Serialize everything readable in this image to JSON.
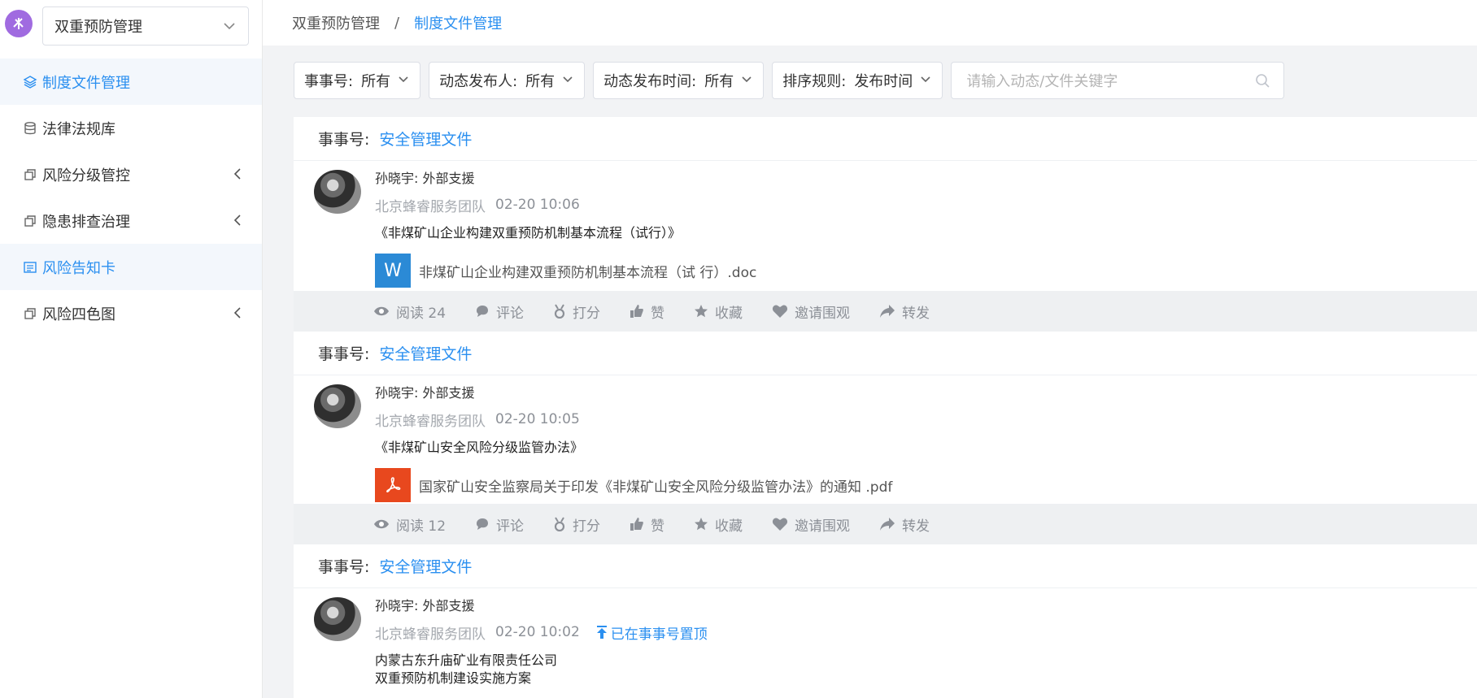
{
  "sidebar": {
    "system_selector": "双重预防管理",
    "items": [
      {
        "label": "制度文件管理",
        "icon": "layers-icon",
        "active": true,
        "expandable": false
      },
      {
        "label": "法律法规库",
        "icon": "database-icon",
        "active": false,
        "expandable": false
      },
      {
        "label": "风险分级管控",
        "icon": "copy-icon",
        "active": false,
        "expandable": true
      },
      {
        "label": "隐患排查治理",
        "icon": "copy-icon",
        "active": false,
        "expandable": true
      },
      {
        "label": "风险告知卡",
        "icon": "card-icon",
        "active": true,
        "expandable": false
      },
      {
        "label": "风险四色图",
        "icon": "copy-icon",
        "active": false,
        "expandable": true
      }
    ]
  },
  "breadcrumb": {
    "parent": "双重预防管理",
    "separator": "/",
    "current": "制度文件管理"
  },
  "filters": [
    {
      "label": "事事号:",
      "value": "所有"
    },
    {
      "label": "动态发布人:",
      "value": "所有"
    },
    {
      "label": "动态发布时间:",
      "value": "所有"
    },
    {
      "label": "排序规则:",
      "value": "发布时间"
    }
  ],
  "search": {
    "placeholder": "请输入动态/文件关键字"
  },
  "posts": [
    {
      "category_label": "事事号:",
      "category": "安全管理文件",
      "author": "孙晓宇: 外部支援",
      "team": "北京蜂睿服务团队",
      "time": "02-20 10:06",
      "title": "《非煤矿山企业构建双重预防机制基本流程（试行）》",
      "attachment": {
        "type": "word",
        "glyph": "W",
        "name": "非煤矿山企业构建双重预防机制基本流程（试 行）.doc"
      },
      "actions": {
        "read": "阅读 24",
        "comment": "评论",
        "score": "打分",
        "like": "赞",
        "favorite": "收藏",
        "invite": "邀请围观",
        "forward": "转发"
      }
    },
    {
      "category_label": "事事号:",
      "category": "安全管理文件",
      "author": "孙晓宇: 外部支援",
      "team": "北京蜂睿服务团队",
      "time": "02-20 10:05",
      "title": "《非煤矿山安全风险分级监管办法》",
      "attachment": {
        "type": "pdf",
        "glyph": "",
        "name": "国家矿山安全监察局关于印发《非煤矿山安全风险分级监管办法》的通知 .pdf"
      },
      "actions": {
        "read": "阅读 12",
        "comment": "评论",
        "score": "打分",
        "like": "赞",
        "favorite": "收藏",
        "invite": "邀请围观",
        "forward": "转发"
      }
    },
    {
      "category_label": "事事号:",
      "category": "安全管理文件",
      "author": "孙晓宇: 外部支援",
      "team": "北京蜂睿服务团队",
      "time": "02-20 10:02",
      "pinned": "已在事事号置顶",
      "title_line1": "内蒙古东升庙矿业有限责任公司",
      "title_line2": "双重预防机制建设实施方案"
    }
  ],
  "colors": {
    "accent": "#2a8ff0",
    "logo": "#a06be0",
    "word": "#2b8ad6",
    "pdf": "#e8481e"
  }
}
